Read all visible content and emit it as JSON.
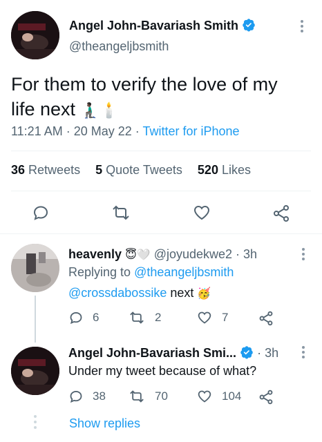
{
  "main_tweet": {
    "author_name": "Angel John-Bavariash Smith",
    "handle": "@theangeljbsmith",
    "text_line1": "For them to verify the love of my",
    "text_line2": "life next",
    "emoji": "🧎🏿‍♂️🕯️",
    "time": "11:21 AM",
    "date": "20 May 22",
    "source": "Twitter for iPhone",
    "retweets_count": "36",
    "retweets_label": "Retweets",
    "quotes_count": "5",
    "quotes_label": "Quote Tweets",
    "likes_count": "520",
    "likes_label": "Likes"
  },
  "replies": [
    {
      "name": "heavenly",
      "name_emoji": "😇🤍",
      "handle": "@joyudekwe2",
      "time": "3h",
      "replying_prefix": "Replying to",
      "replying_to": "@theangeljbsmith",
      "mention": "@crossdabossike",
      "text": "next",
      "text_emoji": "🥳",
      "reply_count": "6",
      "retweet_count": "2",
      "like_count": "7"
    },
    {
      "name": "Angel John-Bavariash Smi...",
      "handle": "",
      "time": "3h",
      "text": "Under my tweet because of what?",
      "reply_count": "38",
      "retweet_count": "70",
      "like_count": "104"
    }
  ],
  "show_replies_label": "Show replies",
  "colors": {
    "accent": "#1d9bf0",
    "text": "#0f1419",
    "muted": "#536471",
    "divider": "#eff3f4"
  },
  "icons": [
    "verified-badge-icon",
    "more-dots-icon",
    "reply-icon",
    "retweet-icon",
    "like-icon",
    "share-icon"
  ]
}
